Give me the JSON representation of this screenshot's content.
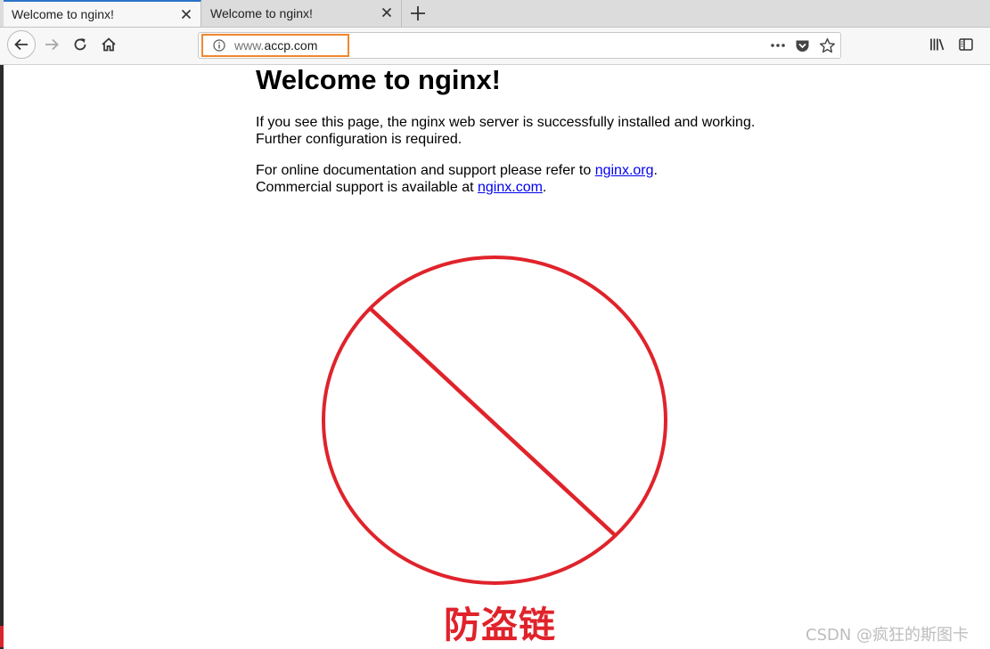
{
  "tabs": [
    {
      "title": "Welcome to nginx!",
      "active": true
    },
    {
      "title": "Welcome to nginx!",
      "active": false
    }
  ],
  "urlbar": {
    "host_prefix": "www.",
    "host_domain": "accp.com",
    "highlight_color": "#f0872d"
  },
  "page": {
    "heading": "Welcome to nginx!",
    "para1_line1": "If you see this page, the nginx web server is successfully installed and working.",
    "para1_line2": "Further configuration is required.",
    "para2_line1_text": "For online documentation and support please refer to ",
    "para2_link1": "nginx.org",
    "para2_line1_end": ".",
    "para2_line2_text": "Commercial support is available at ",
    "para2_link2": "nginx.com",
    "para2_line2_end": "."
  },
  "overlay": {
    "caption": "防盗链",
    "sign_color": "#e0232b",
    "watermark": "CSDN @疯狂的斯图卡"
  },
  "icons": [
    "close-icon",
    "plus-icon",
    "back-arrow-icon",
    "forward-arrow-icon",
    "reload-icon",
    "home-icon",
    "info-icon",
    "more-dots-icon",
    "pocket-icon",
    "star-icon",
    "library-icon",
    "sidebar-icon"
  ]
}
